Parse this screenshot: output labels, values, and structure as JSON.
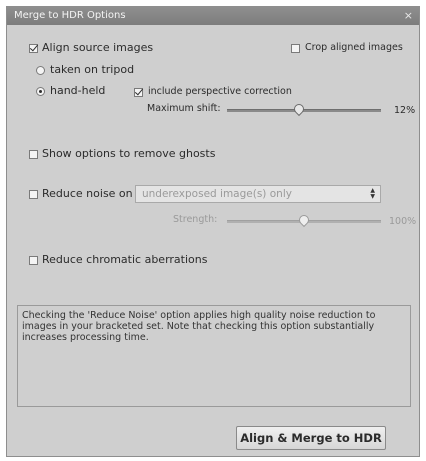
{
  "window": {
    "title": "Merge to HDR Options",
    "close_glyph": "×"
  },
  "align": {
    "label": "Align source images",
    "checked": true,
    "crop_label": "Crop aligned images",
    "crop_checked": false,
    "tripod_label": "taken on tripod",
    "handheld_label": "hand-held",
    "handheld_selected": true,
    "perspective_label": "include perspective correction",
    "perspective_checked": true,
    "max_shift_label": "Maximum shift:",
    "max_shift_value": "12%",
    "max_shift_fraction": 0.47
  },
  "ghosts": {
    "label": "Show options to remove ghosts",
    "checked": false
  },
  "noise": {
    "label": "Reduce noise on",
    "checked": false,
    "select_value": "underexposed image(s) only",
    "strength_label": "Strength:",
    "strength_value": "100%",
    "strength_fraction": 0.5
  },
  "chromatic": {
    "label": "Reduce chromatic aberrations",
    "checked": false
  },
  "info": {
    "text": "Checking the 'Reduce Noise' option applies high quality noise reduction to images in your bracketed set. Note that checking this option substantially increases processing time."
  },
  "actions": {
    "merge_label": "Align & Merge to HDR"
  }
}
